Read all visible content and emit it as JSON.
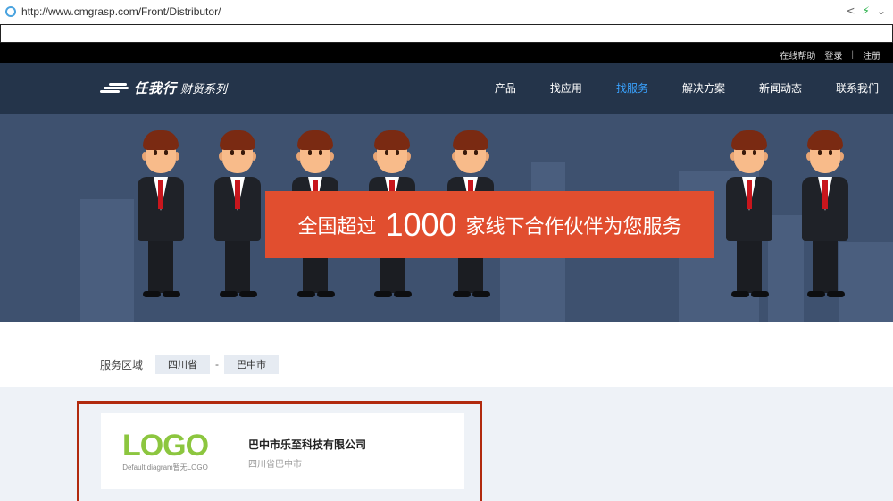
{
  "browser": {
    "url": "http://www.cmgrasp.com/Front/Distributor/",
    "icons": [
      "share-icon",
      "lightning-icon",
      "chevron-down-icon"
    ]
  },
  "topbar": {
    "help": "在线帮助",
    "login": "登录",
    "separator": "|",
    "register": "注册"
  },
  "nav": {
    "brand": "任我行",
    "brand_sub": "财贸系列",
    "items": [
      {
        "label": "产品",
        "active": false
      },
      {
        "label": "找应用",
        "active": false
      },
      {
        "label": "找服务",
        "active": true
      },
      {
        "label": "解决方案",
        "active": false
      },
      {
        "label": "新闻动态",
        "active": false
      },
      {
        "label": "联系我们",
        "active": false
      }
    ],
    "active_color": "#3aa3ff"
  },
  "banner": {
    "text_pre": "全国超过",
    "number": "1000",
    "text_post": "家线下合作伙伴为您服务",
    "sign_color": "#e14e2f",
    "background": "#3e516f"
  },
  "filter": {
    "label": "服务区域",
    "province": "四川省",
    "dash": "-",
    "city": "巴中市"
  },
  "results": [
    {
      "logo_text": "LOGO",
      "logo_caption": "Default diagram暂无LOGO",
      "name": "巴中市乐至科技有限公司",
      "area": "四川省巴中市"
    }
  ],
  "highlight_color": "#b12a0e"
}
